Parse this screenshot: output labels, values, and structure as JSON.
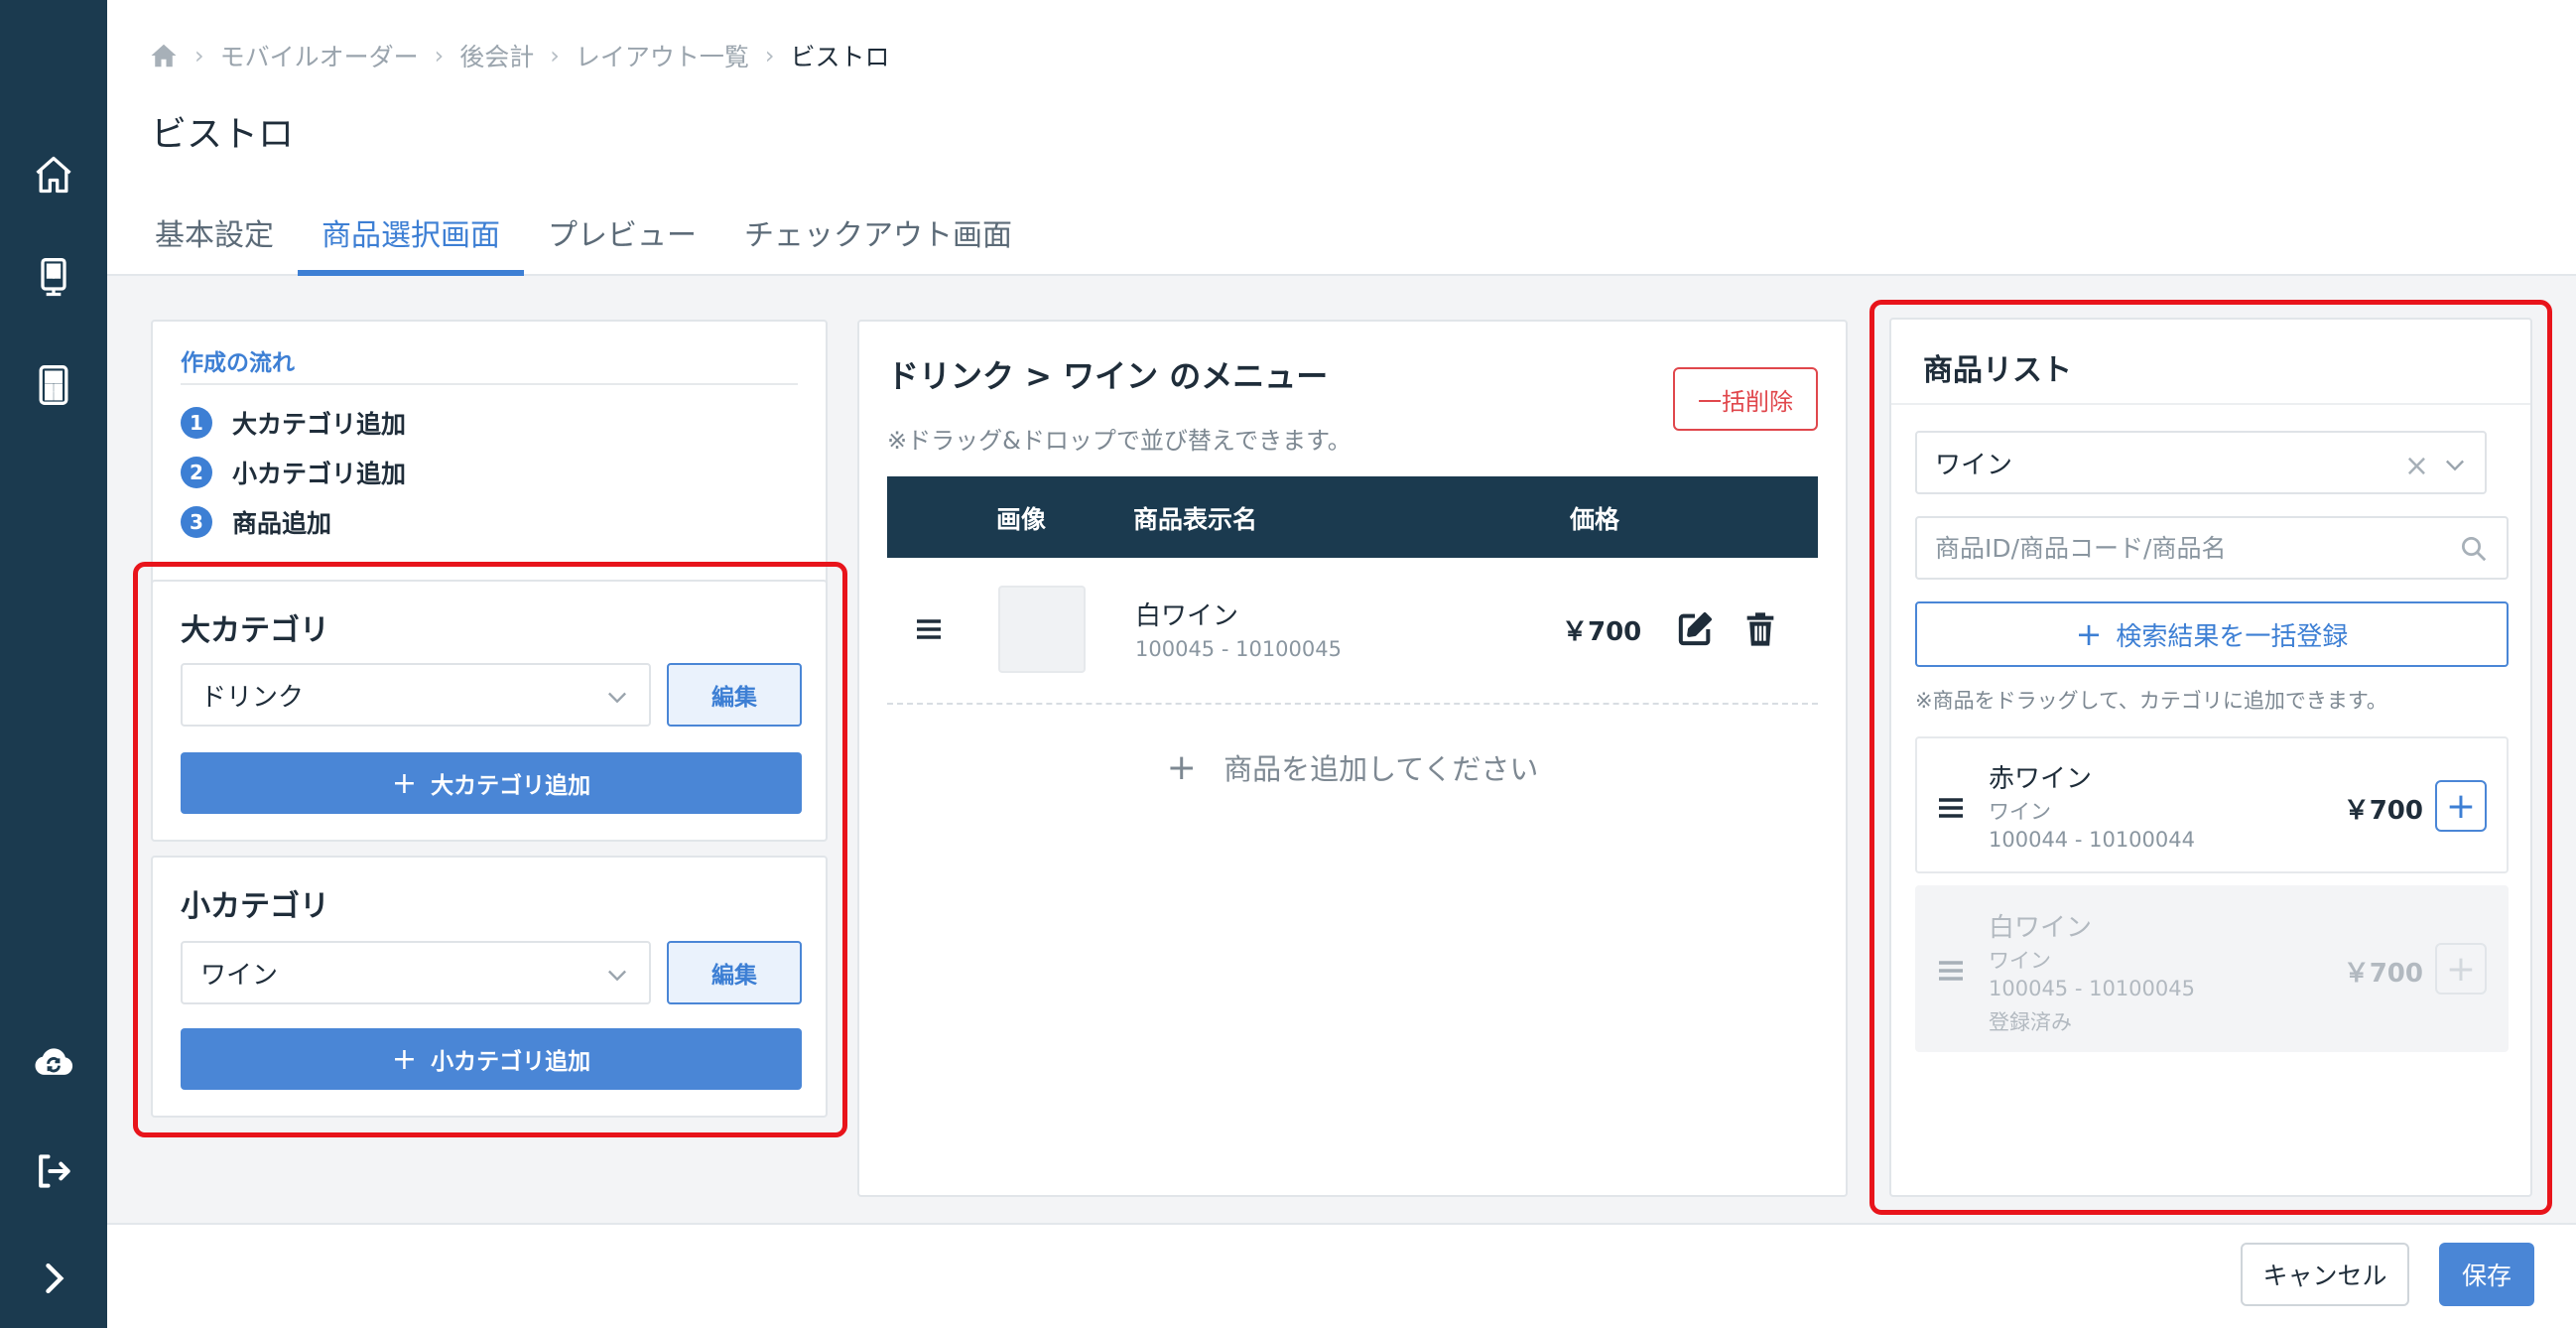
{
  "sidebar": {
    "icons": [
      "home-icon",
      "kiosk-icon",
      "tablet-icon",
      "cloud-sync-icon",
      "logout-icon",
      "chevron-right-icon"
    ]
  },
  "breadcrumb": {
    "items": [
      "モバイルオーダー",
      "後会計",
      "レイアウト一覧"
    ],
    "current": "ビストロ"
  },
  "page": {
    "title": "ビストロ"
  },
  "tabs": [
    {
      "label": "基本設定",
      "active": false
    },
    {
      "label": "商品選択画面",
      "active": true
    },
    {
      "label": "プレビュー",
      "active": false
    },
    {
      "label": "チェックアウト画面",
      "active": false
    }
  ],
  "flow": {
    "title": "作成の流れ",
    "steps": [
      {
        "num": "1",
        "label": "大カテゴリ追加"
      },
      {
        "num": "2",
        "label": "小カテゴリ追加"
      },
      {
        "num": "3",
        "label": "商品追加"
      }
    ]
  },
  "major_category": {
    "heading": "大カテゴリ",
    "selected": "ドリンク",
    "edit_label": "編集",
    "add_label": "大カテゴリ追加"
  },
  "minor_category": {
    "heading": "小カテゴリ",
    "selected": "ワイン",
    "edit_label": "編集",
    "add_label": "小カテゴリ追加"
  },
  "menu": {
    "title": "ドリンク > ワイン のメニュー",
    "note": "※ドラッグ&ドロップで並び替えできます。",
    "delete_all_label": "一括削除",
    "columns": {
      "image": "画像",
      "name": "商品表示名",
      "price": "価格"
    },
    "rows": [
      {
        "name": "白ワイン",
        "code": "100045 - 10100045",
        "price": "￥700"
      }
    ],
    "add_product_label": "商品を追加してください"
  },
  "product_list": {
    "title": "商品リスト",
    "category_filter": "ワイン",
    "search_placeholder": "商品ID/商品コード/商品名",
    "bulk_register_label": "検索結果を一括登録",
    "note": "※商品をドラッグして、カテゴリに追加できます。",
    "items": [
      {
        "name": "赤ワイン",
        "category": "ワイン",
        "code": "100044 - 10100044",
        "price": "￥700",
        "registered_label": "",
        "disabled": false
      },
      {
        "name": "白ワイン",
        "category": "ワイン",
        "code": "100045 - 10100045",
        "price": "￥700",
        "registered_label": "登録済み",
        "disabled": true
      }
    ]
  },
  "footer": {
    "cancel_label": "キャンセル",
    "save_label": "保存"
  },
  "colors": {
    "sidebar": "#1b3a4f",
    "accent": "#4a86d6",
    "table_header": "#1b3a4f",
    "danger": "#e0474c",
    "highlight": "#e8141b"
  }
}
